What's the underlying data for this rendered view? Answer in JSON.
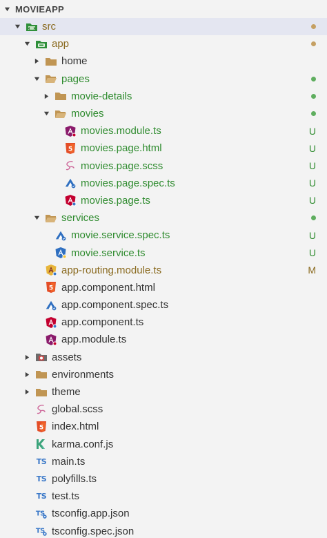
{
  "explorer": {
    "title": "MOVIEAPP",
    "items": [
      {
        "label": "src",
        "depth": 0,
        "kind": "folder-src",
        "twistie": "open",
        "status": "brown",
        "badge": "",
        "dot": "brown",
        "selected": true
      },
      {
        "label": "app",
        "depth": 1,
        "kind": "folder-app",
        "twistie": "open",
        "status": "brown",
        "badge": "",
        "dot": "brown"
      },
      {
        "label": "home",
        "depth": 2,
        "kind": "folder",
        "twistie": "closed",
        "status": "",
        "badge": "",
        "dot": ""
      },
      {
        "label": "pages",
        "depth": 2,
        "kind": "folder-open",
        "twistie": "open",
        "status": "green",
        "badge": "",
        "dot": "green"
      },
      {
        "label": "movie-details",
        "depth": 3,
        "kind": "folder",
        "twistie": "closed",
        "status": "green",
        "badge": "",
        "dot": "green"
      },
      {
        "label": "movies",
        "depth": 3,
        "kind": "folder-open",
        "twistie": "open",
        "status": "green",
        "badge": "",
        "dot": "green"
      },
      {
        "label": "movies.module.ts",
        "depth": 4,
        "kind": "angular-module",
        "twistie": "",
        "status": "green",
        "badge": "U",
        "dot": ""
      },
      {
        "label": "movies.page.html",
        "depth": 4,
        "kind": "html",
        "twistie": "",
        "status": "green",
        "badge": "U",
        "dot": ""
      },
      {
        "label": "movies.page.scss",
        "depth": 4,
        "kind": "sass",
        "twistie": "",
        "status": "green",
        "badge": "U",
        "dot": ""
      },
      {
        "label": "movies.page.spec.ts",
        "depth": 4,
        "kind": "spec",
        "twistie": "",
        "status": "green",
        "badge": "U",
        "dot": ""
      },
      {
        "label": "movies.page.ts",
        "depth": 4,
        "kind": "angular-component",
        "twistie": "",
        "status": "green",
        "badge": "U",
        "dot": ""
      },
      {
        "label": "services",
        "depth": 2,
        "kind": "folder-open",
        "twistie": "open",
        "status": "green",
        "badge": "",
        "dot": "green"
      },
      {
        "label": "movie.service.spec.ts",
        "depth": 3,
        "kind": "spec",
        "twistie": "",
        "status": "green",
        "badge": "U",
        "dot": ""
      },
      {
        "label": "movie.service.ts",
        "depth": 3,
        "kind": "angular-service",
        "twistie": "",
        "status": "green",
        "badge": "U",
        "dot": ""
      },
      {
        "label": "app-routing.module.ts",
        "depth": 2,
        "kind": "angular-routing",
        "twistie": "",
        "status": "brown",
        "badge": "M",
        "dot": ""
      },
      {
        "label": "app.component.html",
        "depth": 2,
        "kind": "html",
        "twistie": "",
        "status": "",
        "badge": "",
        "dot": ""
      },
      {
        "label": "app.component.spec.ts",
        "depth": 2,
        "kind": "spec",
        "twistie": "",
        "status": "",
        "badge": "",
        "dot": ""
      },
      {
        "label": "app.component.ts",
        "depth": 2,
        "kind": "angular-component",
        "twistie": "",
        "status": "",
        "badge": "",
        "dot": ""
      },
      {
        "label": "app.module.ts",
        "depth": 2,
        "kind": "angular-module",
        "twistie": "",
        "status": "",
        "badge": "",
        "dot": ""
      },
      {
        "label": "assets",
        "depth": 1,
        "kind": "folder-assets",
        "twistie": "closed",
        "status": "",
        "badge": "",
        "dot": ""
      },
      {
        "label": "environments",
        "depth": 1,
        "kind": "folder",
        "twistie": "closed",
        "status": "",
        "badge": "",
        "dot": ""
      },
      {
        "label": "theme",
        "depth": 1,
        "kind": "folder",
        "twistie": "closed",
        "status": "",
        "badge": "",
        "dot": ""
      },
      {
        "label": "global.scss",
        "depth": 1,
        "kind": "sass",
        "twistie": "",
        "status": "",
        "badge": "",
        "dot": ""
      },
      {
        "label": "index.html",
        "depth": 1,
        "kind": "html",
        "twistie": "",
        "status": "",
        "badge": "",
        "dot": ""
      },
      {
        "label": "karma.conf.js",
        "depth": 1,
        "kind": "karma",
        "twistie": "",
        "status": "",
        "badge": "",
        "dot": ""
      },
      {
        "label": "main.ts",
        "depth": 1,
        "kind": "ts",
        "twistie": "",
        "status": "",
        "badge": "",
        "dot": ""
      },
      {
        "label": "polyfills.ts",
        "depth": 1,
        "kind": "ts",
        "twistie": "",
        "status": "",
        "badge": "",
        "dot": ""
      },
      {
        "label": "test.ts",
        "depth": 1,
        "kind": "ts",
        "twistie": "",
        "status": "",
        "badge": "",
        "dot": ""
      },
      {
        "label": "tsconfig.app.json",
        "depth": 1,
        "kind": "tsconfig",
        "twistie": "",
        "status": "",
        "badge": "",
        "dot": ""
      },
      {
        "label": "tsconfig.spec.json",
        "depth": 1,
        "kind": "tsconfig",
        "twistie": "",
        "status": "",
        "badge": "",
        "dot": ""
      }
    ]
  },
  "icon_glyphs": {
    "ts": "TS"
  },
  "colors": {
    "git_untracked": "#2e8b2e",
    "git_modified": "#8a6a1f",
    "selection": "#e4e6f1",
    "angular_red": "#c3002f",
    "angular_purple": "#8a1a6b",
    "html_orange": "#e44d26",
    "ts_blue": "#3a78c8",
    "folder_tan": "#c09553"
  }
}
